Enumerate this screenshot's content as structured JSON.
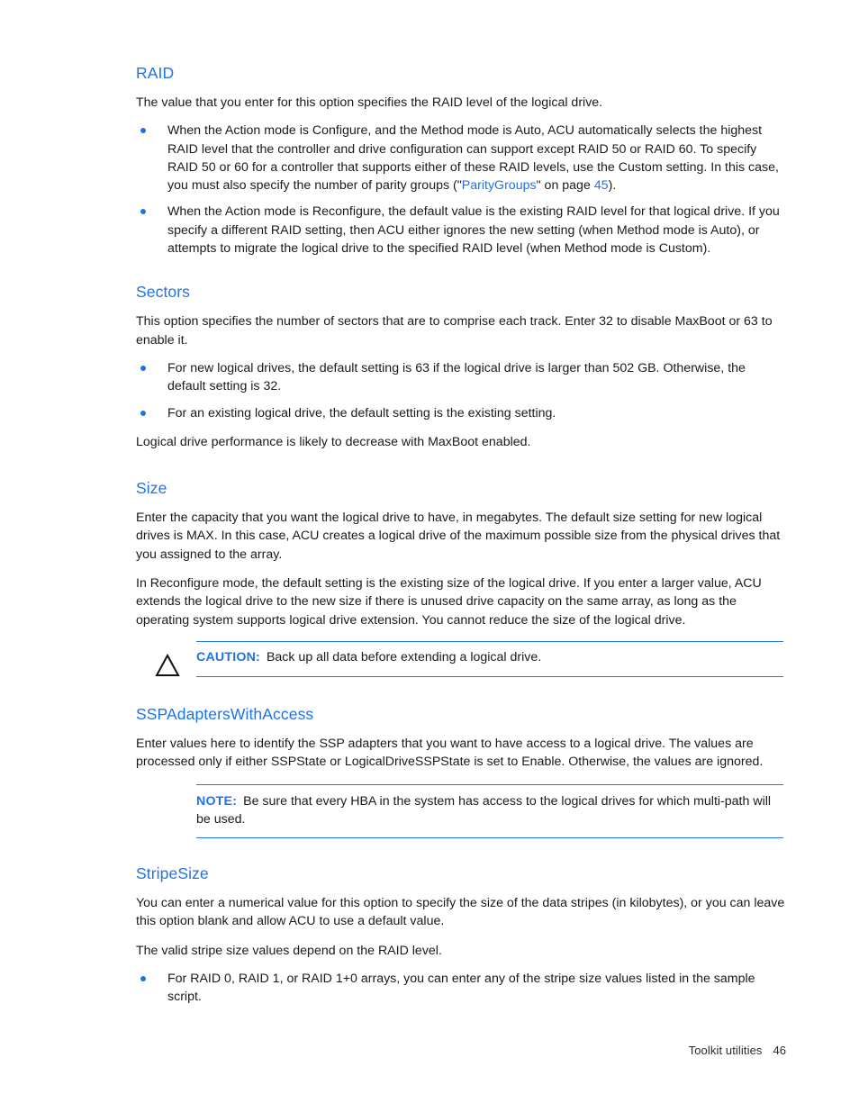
{
  "document": {
    "footer": {
      "label": "Toolkit utilities",
      "page_number": "46"
    },
    "colors": {
      "heading_blue": "#1f72e8",
      "link_blue": "#1f72e8",
      "body_black": "#1a1a1a"
    }
  },
  "sections": [
    {
      "id": "raid",
      "heading": "RAID",
      "intro": "The value that you enter for this option specifies the RAID level of the logical drive.",
      "bullets": [
        {
          "text_before_link": "When the Action mode is Configure, and the Method mode is Auto, ACU automatically selects the highest RAID level that the controller and drive configuration can support except RAID 50 or RAID 60. To specify RAID 50 or 60 for a controller that supports either of these RAID levels, use the Custom setting. In this case, you must also specify the number of parity groups (\"",
          "link_text": "ParityGroups",
          "text_middle": "\" on page ",
          "page_ref": "45",
          "text_after": ")."
        },
        {
          "text": "When the Action mode is Reconfigure, the default value is the existing RAID level for that logical drive. If you specify a different RAID setting, then ACU either ignores the new setting (when Method mode is Auto), or attempts to migrate the logical drive to the specified RAID level (when Method mode is Custom)."
        }
      ]
    },
    {
      "id": "sectors",
      "heading": "Sectors",
      "intro": "This option specifies the number of sectors that are to comprise each track. Enter 32 to disable MaxBoot or 63 to enable it.",
      "bullets": [
        {
          "text": "For new logical drives, the default setting is 63 if the logical drive is larger than 502 GB. Otherwise, the default setting is 32."
        },
        {
          "text": "For an existing logical drive, the default setting is the existing setting."
        }
      ],
      "outro": "Logical drive performance is likely to decrease with MaxBoot enabled."
    },
    {
      "id": "size",
      "heading": "Size",
      "paragraph_1": "Enter the capacity that you want the logical drive to have, in megabytes. The default size setting for new logical drives is MAX. In this case, ACU creates a logical drive of the maximum possible size from the physical drives that you assigned to the array.",
      "paragraph_2": "In Reconfigure mode, the default setting is the existing size of the logical drive. If you enter a larger value, ACU extends the logical drive to the new size if there is unused drive capacity on the same array, as long as the operating system supports logical drive extension. You cannot reduce the size of the logical drive.",
      "caution": {
        "icon": "warning-triangle-icon",
        "label": "CAUTION:",
        "text": "Back up all data before extending a logical drive."
      }
    },
    {
      "id": "sspadapterswithaccess",
      "heading": "SSPAdaptersWithAccess",
      "paragraph_1": "Enter values here to identify the SSP adapters that you want to have access to a logical drive. The values are processed only if either SSPState or LogicalDriveSSPState is set to Enable. Otherwise, the values are ignored.",
      "note": {
        "label": "NOTE:",
        "text": "Be sure that every HBA in the system has access to the logical drives for which multi-path will be used."
      }
    },
    {
      "id": "stripesize",
      "heading": "StripeSize",
      "paragraph_1": "You can enter a numerical value for this option to specify the size of the data stripes (in kilobytes), or you can leave this option blank and allow ACU to use a default value.",
      "paragraph_2": "The valid stripe size values depend on the RAID level.",
      "bullets": [
        {
          "text": "For RAID 0, RAID 1, or RAID 1+0 arrays, you can enter any of the stripe size values listed in the sample script."
        }
      ]
    }
  ]
}
